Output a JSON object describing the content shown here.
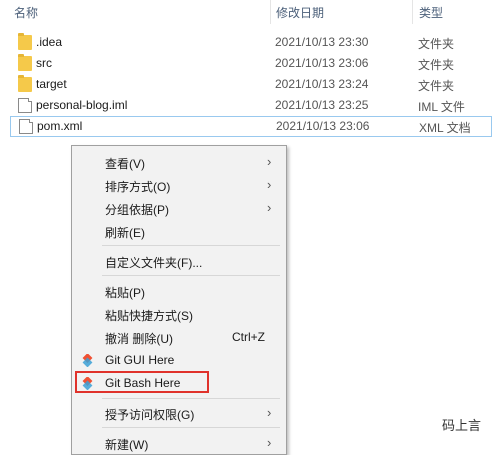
{
  "header": {
    "name": "名称",
    "date": "修改日期",
    "type": "类型"
  },
  "files": [
    {
      "name": ".idea",
      "date": "2021/10/13 23:30",
      "type": "文件夹",
      "kind": "folder"
    },
    {
      "name": "src",
      "date": "2021/10/13 23:06",
      "type": "文件夹",
      "kind": "folder"
    },
    {
      "name": "target",
      "date": "2021/10/13 23:24",
      "type": "文件夹",
      "kind": "folder"
    },
    {
      "name": "personal-blog.iml",
      "date": "2021/10/13 23:25",
      "type": "IML 文件",
      "kind": "file"
    },
    {
      "name": "pom.xml",
      "date": "2021/10/13 23:06",
      "type": "XML 文档",
      "kind": "file"
    }
  ],
  "menu": {
    "view": "查看(V)",
    "sort": "排序方式(O)",
    "group": "分组依据(P)",
    "refresh": "刷新(E)",
    "customize": "自定义文件夹(F)...",
    "paste": "粘贴(P)",
    "paste_shortcut": "粘贴快捷方式(S)",
    "undo_delete": "撤消 删除(U)",
    "undo_shortcut": "Ctrl+Z",
    "git_gui": "Git GUI Here",
    "git_bash": "Git Bash Here",
    "grant_access": "授予访问权限(G)",
    "new": "新建(W)"
  },
  "icons": {
    "folder": "folder-icon",
    "file": "file-icon",
    "git": "git-icon",
    "submenu": "chevron-right-icon"
  },
  "colors": {
    "highlight_border": "#e0322b",
    "folder": "#f5c94a",
    "selection": "#99c9ef"
  },
  "watermark": "码上言"
}
